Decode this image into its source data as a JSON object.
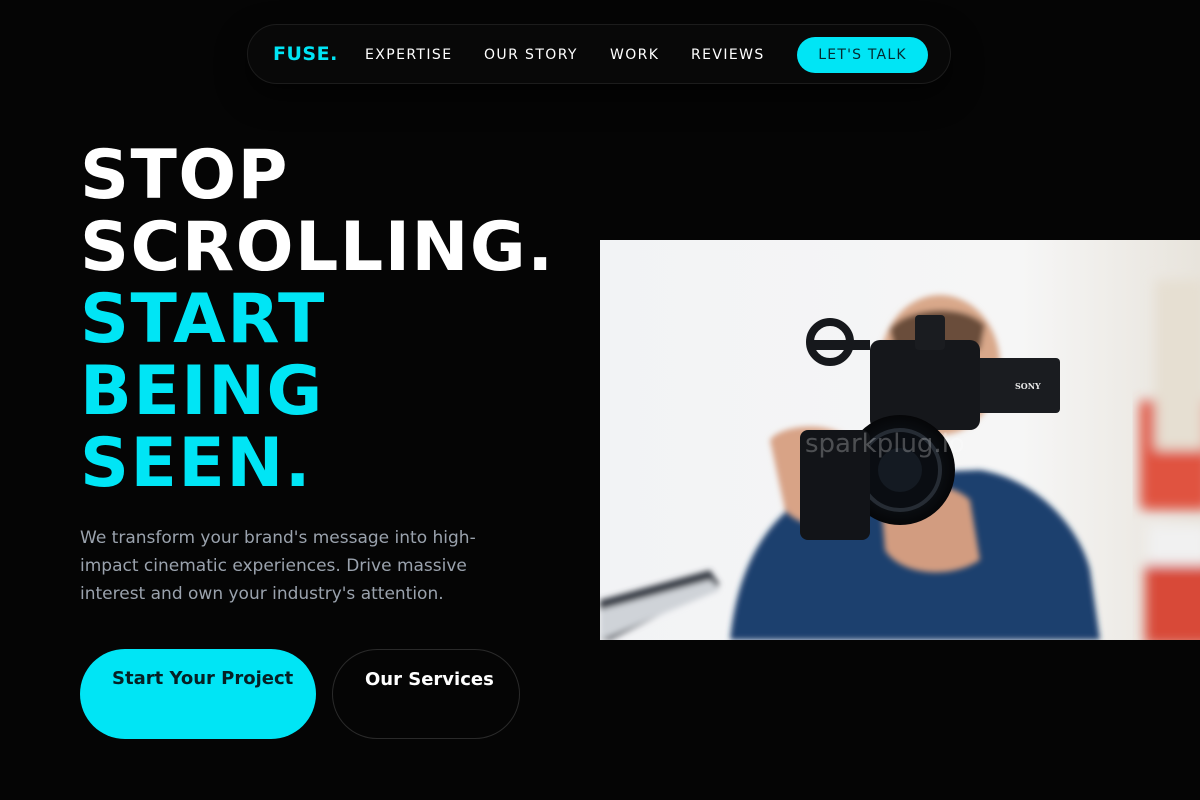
{
  "nav": {
    "logo": "FUSE.",
    "links": [
      "EXPERTISE",
      "OUR STORY",
      "WORK",
      "REVIEWS"
    ],
    "cta": "LET'S TALK"
  },
  "hero": {
    "headline_white": [
      "STOP",
      "SCROLLING."
    ],
    "headline_accent": [
      "START",
      "BEING",
      "SEEN."
    ],
    "description": "We transform your brand's message into high-impact cinematic experiences. Drive massive interest and own your industry's attention.",
    "primary_button": "Start Your Project",
    "secondary_button": "Our Services"
  },
  "photo": {
    "camera_brand": "SONY",
    "watermark": "sparkplug.io"
  },
  "colors": {
    "accent": "#00e5f5",
    "background": "#050505",
    "muted_text": "#9aa2ad"
  }
}
